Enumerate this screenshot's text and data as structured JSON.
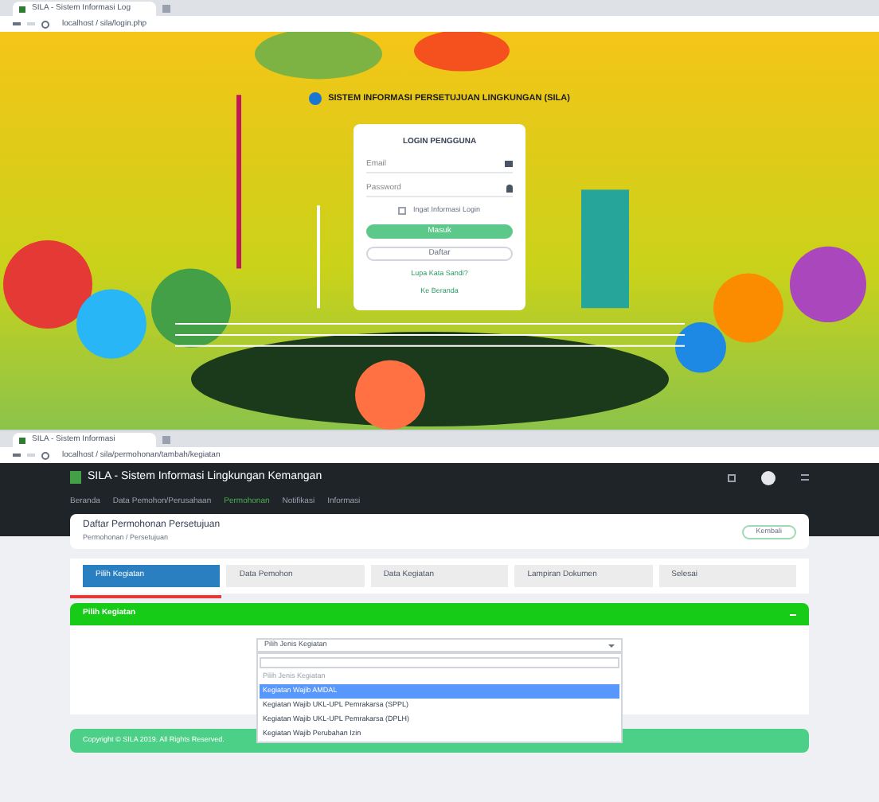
{
  "login_window": {
    "tab_title": "SILA - Sistem Informasi Log",
    "url": "localhost / sila/login.php",
    "heading": "SISTEM INFORMASI PERSETUJUAN LINGKUNGAN (SILA)",
    "card": {
      "title": "LOGIN PENGGUNA",
      "email": {
        "placeholder": "Email"
      },
      "password": {
        "placeholder": "Password"
      },
      "remember": {
        "label": "Ingat Informasi Login",
        "checked": false
      },
      "buttons": [
        "Masuk",
        "Daftar"
      ],
      "links": [
        "Lupa Kata Sandi?",
        "Ke Beranda"
      ]
    }
  },
  "app_window": {
    "tab_title": "SILA - Sistem Informasi",
    "url": "localhost / sila/permohonan/tambah/kegiatan",
    "app_title": "SILA - Sistem Informasi Lingkungan Kemangan",
    "nav": [
      {
        "label": "Beranda",
        "selected": false
      },
      {
        "label": "Data Pemohon/Perusahaan",
        "selected": false
      },
      {
        "label": "Permohonan",
        "selected": true
      },
      {
        "label": "Notifikasi",
        "selected": false
      },
      {
        "label": "Informasi",
        "selected": false
      }
    ],
    "page_title": "Daftar Permohonan Persetujuan",
    "breadcrumb": "Permohonan / Persetujuan",
    "back_button": "Kembali",
    "steps": [
      {
        "label": "Pilih Kegiatan",
        "selected": true
      },
      {
        "label": "Data Pemohon",
        "selected": false
      },
      {
        "label": "Data Kegiatan",
        "selected": false
      },
      {
        "label": "Lampiran Dokumen",
        "selected": false
      },
      {
        "label": "Selesai",
        "selected": false
      }
    ],
    "panel_title": "Pilih Kegiatan",
    "select": {
      "value": "Pilih Jenis Kegiatan",
      "options": [
        {
          "label": "Pilih Jenis Kegiatan",
          "highlighted": false,
          "disabled": true
        },
        {
          "label": "Kegiatan Wajib AMDAL",
          "highlighted": true,
          "disabled": false
        },
        {
          "label": "Kegiatan Wajib UKL-UPL Pemrakarsa (SPPL)",
          "highlighted": false,
          "disabled": false
        },
        {
          "label": "Kegiatan Wajib UKL-UPL Pemrakarsa (DPLH)",
          "highlighted": false,
          "disabled": false
        },
        {
          "label": "Kegiatan Wajib Perubahan Izin",
          "highlighted": false,
          "disabled": false
        }
      ]
    },
    "footer": "Copyright © SILA 2019. All Rights Reserved."
  }
}
